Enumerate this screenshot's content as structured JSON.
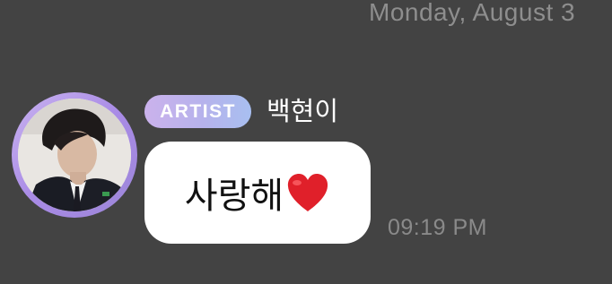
{
  "header": {
    "date": "Monday, August 3"
  },
  "message": {
    "badge": "ARTIST",
    "sender": "백현이",
    "text": "사랑해",
    "emoji": "heart-icon",
    "time": "09:19 PM"
  },
  "colors": {
    "background": "#434343",
    "bubble": "#ffffff",
    "badge_gradient_start": "#cbb2ec",
    "badge_gradient_end": "#a8bff0",
    "heart": "#e0202a"
  }
}
